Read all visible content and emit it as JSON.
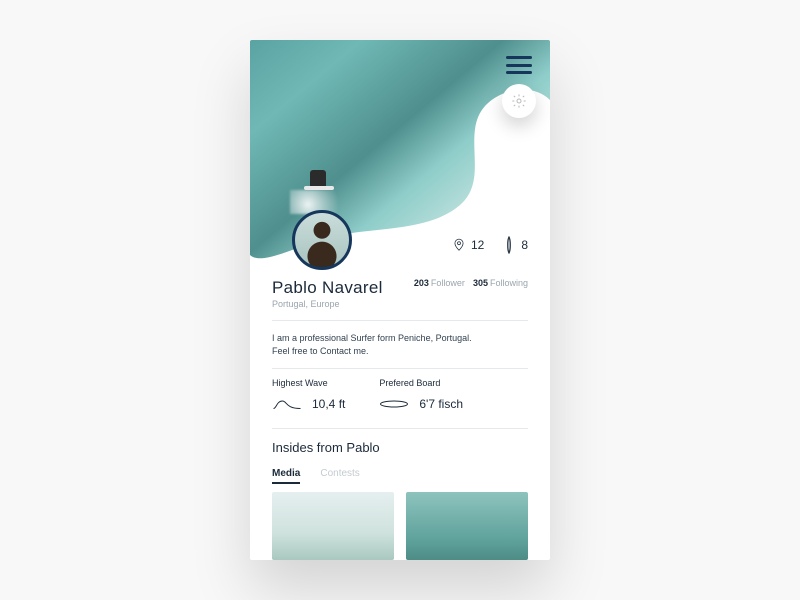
{
  "profile": {
    "name": "Pablo Navarel",
    "location": "Portugal, Europe",
    "bio_line1": "I am a professional Surfer form Peniche, Portugal.",
    "bio_line2": "Feel free to Contact me."
  },
  "stats": {
    "spots": "12",
    "boards": "8",
    "followers_count": "203",
    "followers_label": "Follower",
    "following_count": "305",
    "following_label": "Following"
  },
  "metrics": {
    "wave_label": "Highest Wave",
    "wave_value": "10,4 ft",
    "board_label": "Prefered Board",
    "board_value": "6'7 fisch"
  },
  "section": {
    "title": "Insides from Pablo",
    "tabs": {
      "media": "Media",
      "contests": "Contests"
    }
  }
}
